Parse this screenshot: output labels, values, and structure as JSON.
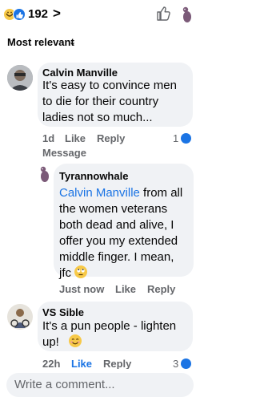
{
  "header": {
    "reaction_count": "192",
    "chevron": ">"
  },
  "sort": {
    "label": "Most relevant",
    "chevron": "⌄"
  },
  "comments": [
    {
      "author": "Calvin Manville",
      "text_line1": "It's easy to convince men",
      "text_line2": "to die for their country",
      "text_line3": "ladies not so much...",
      "time": "1d",
      "like": "Like",
      "reply": "Reply",
      "message": "Message",
      "reaction_count": "1"
    },
    {
      "author": "Tyrannowhale",
      "mention": "Calvin Manville",
      "text_line1_rest": " from all",
      "text_line2": "the women veterans",
      "text_line3": "both dead and alive, I",
      "text_line4": "offer you my extended",
      "text_line5": "middle finger. I mean,",
      "text_line6": "jfc",
      "time": "Just now",
      "like": "Like",
      "reply": "Reply"
    },
    {
      "author": "VS Sible",
      "text_line1": "It's a pun people - lighten",
      "text_line2": "up!",
      "time": "22h",
      "like": "Like",
      "reply": "Reply",
      "reaction_count": "3"
    }
  ],
  "composer": {
    "placeholder": "Write a comment..."
  },
  "colors": {
    "accent": "#1b74e4",
    "bubble": "#f0f2f5",
    "muted": "#65676b"
  }
}
